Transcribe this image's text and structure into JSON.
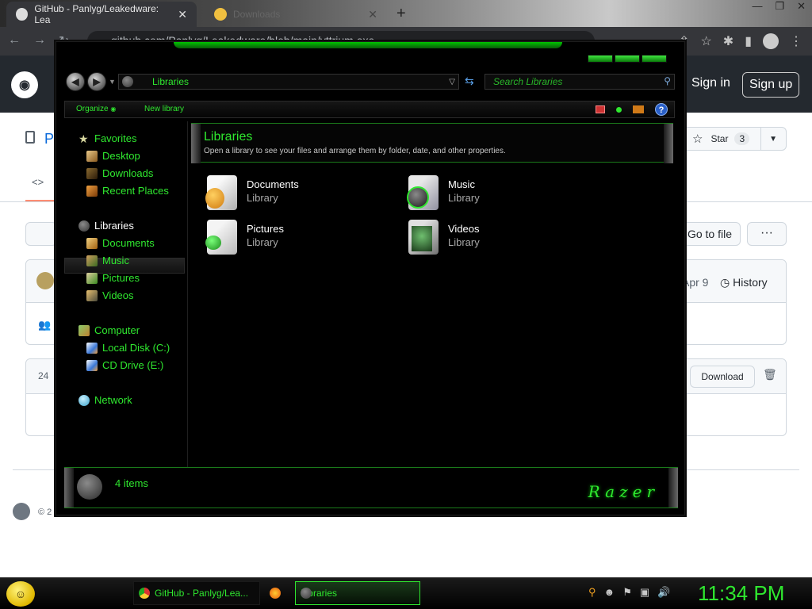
{
  "browser": {
    "tabs": [
      {
        "label": "GitHub - Panlyg/Leakedware: Lea"
      },
      {
        "label": "Downloads"
      }
    ],
    "url": "github.com/Panlyg/Leakedware/blob/main/yttrium.exe"
  },
  "github": {
    "sign_in": "Sign in",
    "sign_up": "Sign up",
    "repo_prefix": "P",
    "star_label": "Star",
    "star_count": "3",
    "go_to_file": "Go to file",
    "more": "···",
    "date": "Apr 9",
    "history": "History",
    "lines": "24",
    "download": "Download",
    "copyright": "© 2"
  },
  "explorer": {
    "address": "Libraries",
    "search_placeholder": "Search Libraries",
    "toolbar": {
      "organize": "Organize",
      "new_library": "New library"
    },
    "sidebar": {
      "favorites": "Favorites",
      "favorites_items": [
        "Desktop",
        "Downloads",
        "Recent Places"
      ],
      "libraries": "Libraries",
      "libraries_items": [
        "Documents",
        "Music",
        "Pictures",
        "Videos"
      ],
      "computer": "Computer",
      "computer_items": [
        "Local Disk (C:)",
        "CD Drive (E:)"
      ],
      "network": "Network"
    },
    "content": {
      "title": "Libraries",
      "description": "Open a library to see your files and arrange them by folder, date, and other properties.",
      "items": [
        {
          "name": "Documents",
          "type": "Library"
        },
        {
          "name": "Music",
          "type": "Library"
        },
        {
          "name": "Pictures",
          "type": "Library"
        },
        {
          "name": "Videos",
          "type": "Library"
        }
      ]
    },
    "status": "4 items",
    "brand": "Razer"
  },
  "taskbar": {
    "items": [
      "GitHub - Panlyg/Lea...",
      "Libraries"
    ],
    "clock": "11:34 PM"
  },
  "colors": {
    "accent": "#2fe82f",
    "window_bg": "#000000",
    "github_header": "#24292f"
  }
}
